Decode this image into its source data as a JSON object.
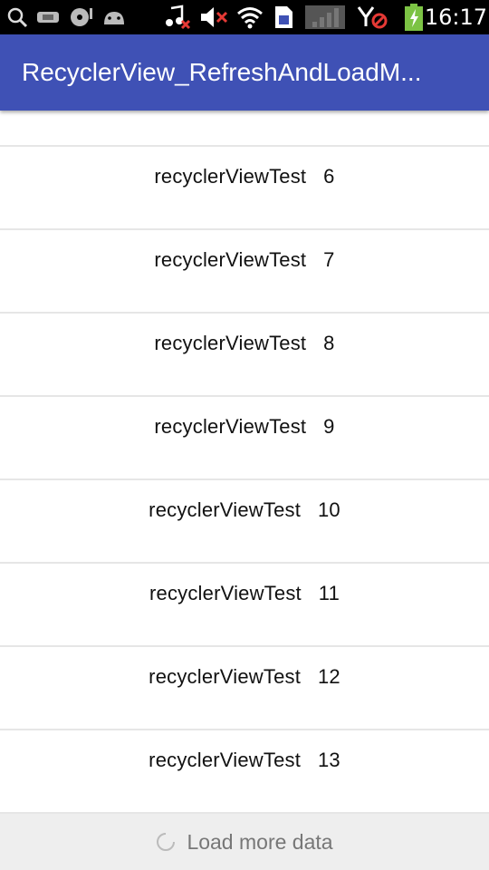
{
  "status_bar": {
    "time": "16:17",
    "left_icons": [
      "search-icon",
      "usb-icon",
      "media-icon",
      "android-icon"
    ],
    "right_icons": [
      "music-off-icon",
      "volume-mute-icon",
      "wifi-icon",
      "sim-icon",
      "signal-icon",
      "no-data-icon",
      "battery-charging-icon"
    ]
  },
  "app_bar": {
    "title": "RecyclerView_RefreshAndLoadM...",
    "color": "#3f51b5"
  },
  "list": {
    "items": [
      {
        "label": "recyclerViewTest   6"
      },
      {
        "label": "recyclerViewTest   7"
      },
      {
        "label": "recyclerViewTest   8"
      },
      {
        "label": "recyclerViewTest   9"
      },
      {
        "label": "recyclerViewTest   10"
      },
      {
        "label": "recyclerViewTest   11"
      },
      {
        "label": "recyclerViewTest   12"
      },
      {
        "label": "recyclerViewTest   13"
      }
    ]
  },
  "footer": {
    "load_more_text": "Load more data",
    "icon": "loading-spinner-icon"
  }
}
